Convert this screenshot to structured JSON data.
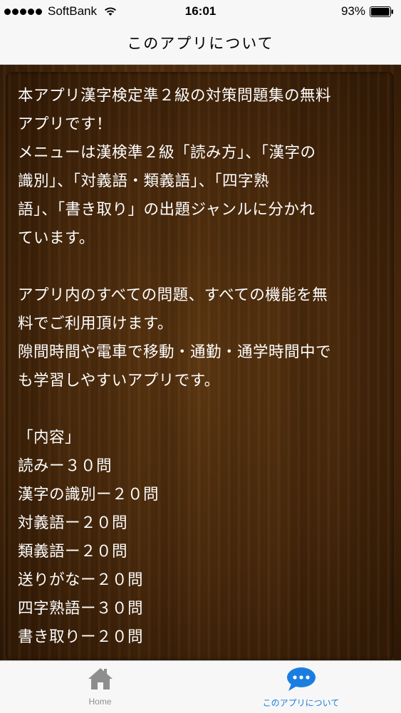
{
  "status_bar": {
    "carrier": "SoftBank",
    "time": "16:01",
    "battery": "93%"
  },
  "nav": {
    "title": "このアプリについて"
  },
  "content": {
    "lines": [
      "本アプリ漢字検定準２級の対策問題集の無料",
      "アプリです！",
      "メニューは漢検準２級「読み方」、「漢字の",
      "識別」、「対義語・類義語」、「四字熟",
      "語」、「書き取り」の出題ジャンルに分かれ",
      "ています。",
      "",
      "アプリ内のすべての問題、すべての機能を無",
      "料でご利用頂けます。",
      "隙間時間や電車で移動・通勤・通学時間中で",
      "も学習しやすいアプリです。",
      "",
      "「内容」",
      "読みー３０問",
      "漢字の識別ー２０問",
      "対義語ー２０問",
      "類義語ー２０問",
      "送りがなー２０問",
      "四字熟語ー３０問",
      "書き取りー２０問"
    ]
  },
  "tabs": {
    "home": {
      "label": "Home",
      "icon": "home-icon"
    },
    "about": {
      "label": "このアプリについて",
      "icon": "speech-bubble-icon"
    }
  },
  "colors": {
    "accent": "#1a7ee0",
    "inactive": "#8e8e8e",
    "wood_dark": "#331b06",
    "wood_light": "#7a4a20",
    "text": "#ffffff"
  }
}
